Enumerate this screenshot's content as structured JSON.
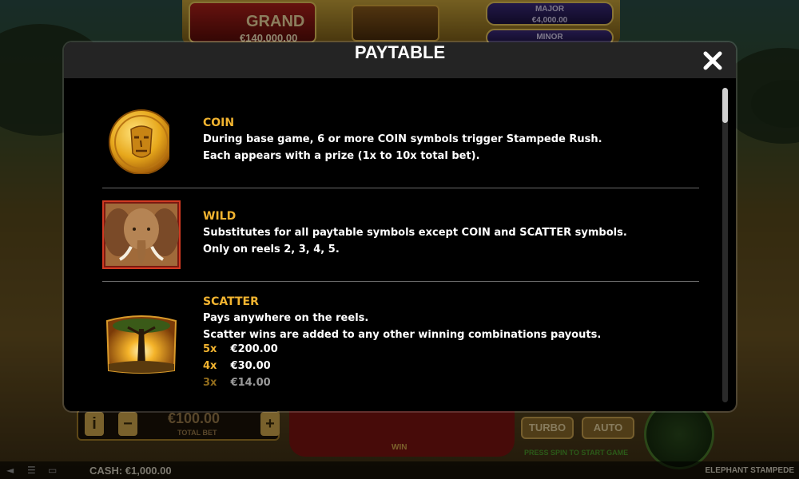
{
  "background": {
    "jackpots": {
      "grand_label": "GRAND",
      "grand_amount": "€140,000.00",
      "major_label": "MAJOR",
      "major_amount": "€4,000.00",
      "minor_label": "MINOR"
    },
    "controls": {
      "info_icon": "i",
      "minus_label": "−",
      "plus_label": "+",
      "bet_amount": "€100.00",
      "bet_label": "TOTAL BET",
      "win_label": "WIN",
      "turbo_label": "TURBO",
      "auto_label": "AUTO",
      "hint_text": "PRESS SPIN TO START GAME"
    },
    "footer": {
      "cash": "CASH: €1,000.00",
      "game_name": "ELEPHANT STAMPEDE"
    }
  },
  "modal": {
    "title": "PAYTABLE",
    "close_icon": "close-x-icon",
    "entries": [
      {
        "name": "COIN",
        "lines": [
          "During base game, 6 or more COIN symbols trigger Stampede Rush.",
          "Each appears with a prize (1x to 10x total bet)."
        ]
      },
      {
        "name": "WILD",
        "lines": [
          "Substitutes for all paytable symbols except COIN and SCATTER symbols.",
          "Only on reels 2, 3, 4, 5."
        ]
      },
      {
        "name": "SCATTER",
        "lines": [
          "Pays anywhere on the reels.",
          "Scatter wins are added to any other winning combinations payouts."
        ],
        "payouts": [
          {
            "mult": "5x",
            "value": "€200.00"
          },
          {
            "mult": "4x",
            "value": "€30.00"
          },
          {
            "mult": "3x",
            "value": "€14.00"
          }
        ]
      }
    ]
  },
  "colors": {
    "accent_gold": "#f2b430",
    "modal_bg": "#000000",
    "header_bg": "#242424",
    "divider": "#6a6a6a"
  }
}
